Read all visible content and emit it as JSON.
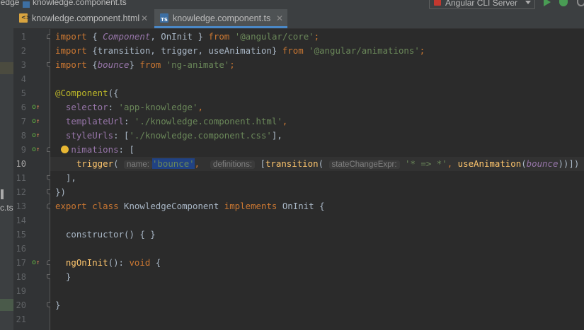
{
  "navbar": {
    "breadcrumb_prefix": "ledge",
    "breadcrumb_sep": "/",
    "breadcrumb_file": "knowledge.component.ts",
    "run_config": "Angular CLI Server"
  },
  "tabs": [
    {
      "label": "knowledge.component.html",
      "icon": "html-file-icon",
      "active": false
    },
    {
      "label": "knowledge.component.ts",
      "icon": "ts-file-icon",
      "active": true
    }
  ],
  "left_strip": {
    "partial_label": "c.ts"
  },
  "editor": {
    "current_line": 10,
    "line_numbers": [
      "1",
      "2",
      "3",
      "4",
      "5",
      "6",
      "7",
      "8",
      "9",
      "10",
      "11",
      "12",
      "13",
      "14",
      "15",
      "16",
      "17",
      "18",
      "19",
      "20",
      "21"
    ],
    "code": {
      "l1": {
        "kw_import": "import",
        "open": "{",
        "component": "Component",
        "comma": ",",
        "oninit": "OnInit",
        "close": "}",
        "kw_from": "from",
        "path": "'@angular/core'",
        "semi": ";"
      },
      "l2": {
        "kw_import": "import",
        "open": "{",
        "names": "transition, trigger, useAnimation",
        "close": "}",
        "kw_from": "from",
        "path": "'@angular/animations'",
        "semi": ";"
      },
      "l3": {
        "kw_import": "import",
        "open": "{",
        "bounce": "bounce",
        "close": "}",
        "kw_from": "from",
        "path": "'ng-animate'",
        "semi": ";"
      },
      "l5": {
        "decorator": "@Component",
        "open": "({"
      },
      "l6": {
        "key": "selector",
        "colon": ":",
        "value": "'app-knowledge'",
        "comma": ","
      },
      "l7": {
        "key": "templateUrl",
        "colon": ":",
        "value": "'./knowledge.component.html'",
        "comma": ","
      },
      "l8": {
        "key": "styleUrls",
        "colon": ":",
        "open": "[",
        "value": "'./knowledge.component.css'",
        "close": "],"
      },
      "l9": {
        "key": "nimations",
        "rest": ": ["
      },
      "l10": {
        "fn_trigger": "trigger",
        "open": "(",
        "hint_name": "name:",
        "name_val": "'bounce'",
        "comma1": ",",
        "hint_defs": "definitions:",
        "bracket": "[",
        "fn_transition": "transition",
        "open2": "(",
        "hint_expr": "stateChangeExpr:",
        "expr_val": "'* => *'",
        "comma2": ",",
        "fn_useanim": "useAnimation",
        "open3": "(",
        "bounce": "bounce",
        "close": "))])"
      },
      "l11": {
        "text": "],"
      },
      "l12": {
        "text": "})"
      },
      "l13": {
        "kw_export": "export",
        "kw_class": "class",
        "name": "KnowledgeComponent",
        "kw_implements": "implements",
        "iface": "OnInit",
        "open": "{"
      },
      "l15": {
        "text": "constructor() { }"
      },
      "l17": {
        "fn": "ngOnInit",
        "paren": "():",
        "kw_void": "void",
        "open": "{"
      },
      "l18": {
        "text": "}"
      },
      "l20": {
        "text": "}"
      }
    }
  }
}
